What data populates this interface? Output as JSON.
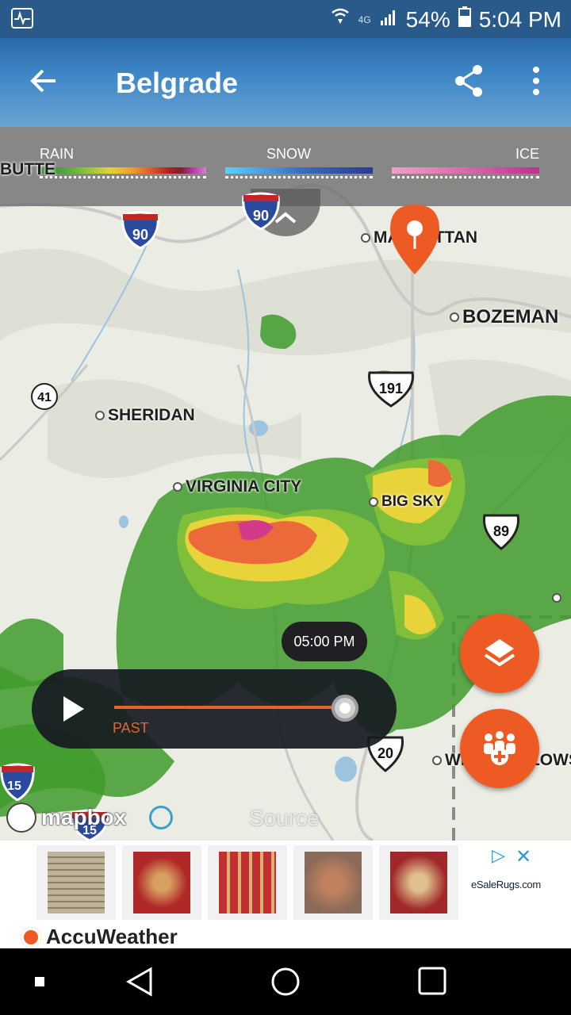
{
  "status_bar": {
    "network": "4G",
    "battery": "54%",
    "time": "5:04 PM"
  },
  "app_bar": {
    "title": "Belgrade"
  },
  "legend": {
    "rain_label": "RAIN",
    "snow_label": "SNOW",
    "ice_label": "ICE"
  },
  "map": {
    "cities": [
      {
        "name": "BUTTE"
      },
      {
        "name": "MANHATTAN"
      },
      {
        "name": "BOZEMAN"
      },
      {
        "name": "SHERIDAN"
      },
      {
        "name": "VIRGINIA CITY"
      },
      {
        "name": "BIG SKY"
      },
      {
        "name": "WEST YELLOWSTONE"
      }
    ],
    "highways": [
      "90",
      "90",
      "41",
      "191",
      "89",
      "20",
      "15",
      "15"
    ],
    "attribution": "mapbox",
    "source_label": "Source"
  },
  "player": {
    "time_tooltip": "05:00 PM",
    "past_label": "PAST"
  },
  "ad": {
    "advertiser": "eSaleRugs.com",
    "footer_brand": "AccuWeather"
  },
  "colors": {
    "accent": "#ee5a24",
    "app_bar": "#3d86c6",
    "player_bg": "#161a22"
  }
}
